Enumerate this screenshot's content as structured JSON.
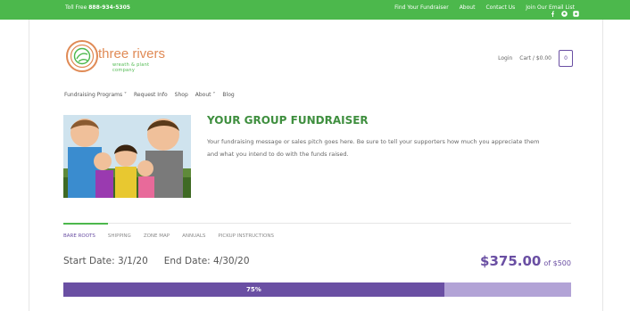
{
  "topbar": {
    "phone_prefix": "Toll Free",
    "phone_number": "888-934-5305",
    "links": [
      "Find Your Fundraiser",
      "About",
      "Contact Us",
      "Join Our Email List"
    ]
  },
  "brand": {
    "name": "three rivers",
    "tagline": "wreath & plant company"
  },
  "header": {
    "login": "Login",
    "cart": "Cart / $0.00",
    "cart_count": "0"
  },
  "nav": {
    "items": [
      "Fundraising Programs ˅",
      "Request Info",
      "Shop",
      "About ˅",
      "Blog"
    ]
  },
  "hero": {
    "title": "YOUR GROUP FUNDRAISER",
    "description": "Your fundraising message or sales pitch goes here. Be sure to tell your supporters how much you appreciate them and what you intend to do with the funds raised."
  },
  "tabs": {
    "items": [
      "BARE ROOTS",
      "SHIPPING",
      "ZONE MAP",
      "ANNUALS",
      "PICKUP INSTRUCTIONS"
    ]
  },
  "details": {
    "start_date": "Start Date: 3/1/20",
    "end_date": "End Date: 4/30/20",
    "amount_raised": "$375.00",
    "goal": "of $500",
    "progress_label": "75%",
    "progress_fraction": 0.75
  },
  "colors": {
    "green": "#4cb84c",
    "purple": "#6a4fa3",
    "purple_light": "#b2a3d6"
  }
}
